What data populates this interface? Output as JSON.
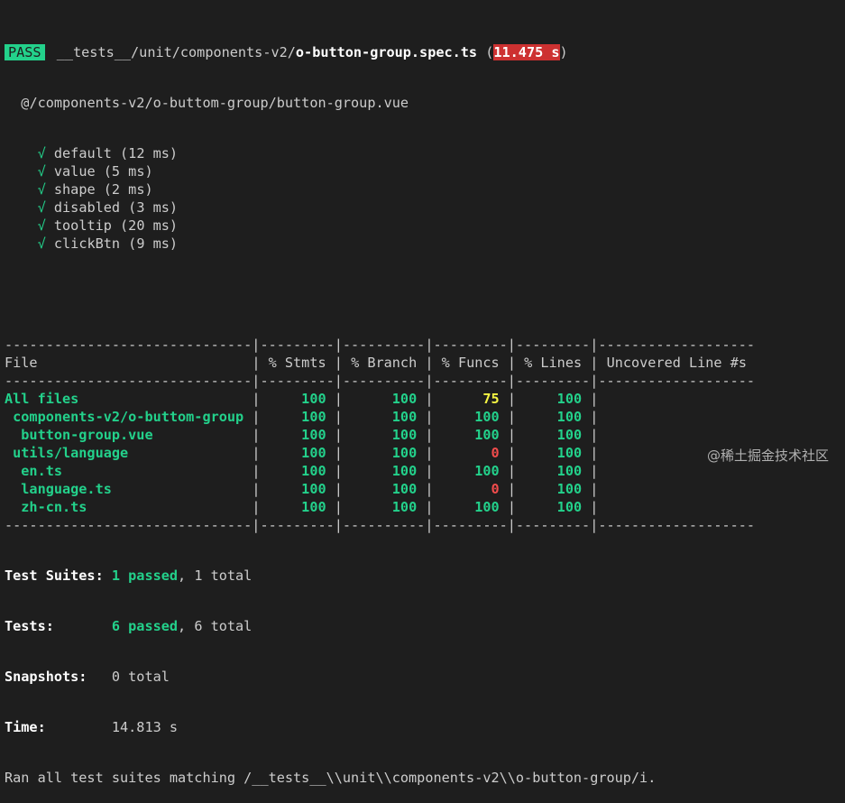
{
  "header": {
    "badge": "PASS",
    "path_dim": "__tests__/unit/components-v2/",
    "path_bold": "o-button-group.spec.ts",
    "time_open": " (",
    "time": "11.475 s",
    "time_close": ")"
  },
  "suite": "@/components-v2/o-buttom-group/button-group.vue",
  "tests": [
    {
      "mark": "√",
      "name": "default (12 ms)"
    },
    {
      "mark": "√",
      "name": "value (5 ms)"
    },
    {
      "mark": "√",
      "name": "shape (2 ms)"
    },
    {
      "mark": "√",
      "name": "disabled (3 ms)"
    },
    {
      "mark": "√",
      "name": "tooltip (20 ms)"
    },
    {
      "mark": "√",
      "name": "clickBtn (9 ms)"
    }
  ],
  "coverage": {
    "separator": "------------------------------|---------|----------|---------|---------|-------------------",
    "headers": [
      "File",
      "% Stmts",
      "% Branch",
      "% Funcs",
      "% Lines",
      "Uncovered Line #s"
    ],
    "rows": [
      {
        "file": "All files",
        "stmts": "100",
        "branch": "100",
        "funcs": "75",
        "lines": "100",
        "uncovered": "",
        "funcs_status": "warn"
      },
      {
        "file": " components-v2/o-buttom-group",
        "stmts": "100",
        "branch": "100",
        "funcs": "100",
        "lines": "100",
        "uncovered": "",
        "funcs_status": "ok"
      },
      {
        "file": "  button-group.vue",
        "stmts": "100",
        "branch": "100",
        "funcs": "100",
        "lines": "100",
        "uncovered": "",
        "funcs_status": "ok"
      },
      {
        "file": " utils/language",
        "stmts": "100",
        "branch": "100",
        "funcs": "0",
        "lines": "100",
        "uncovered": "",
        "funcs_status": "bad"
      },
      {
        "file": "  en.ts",
        "stmts": "100",
        "branch": "100",
        "funcs": "100",
        "lines": "100",
        "uncovered": "",
        "funcs_status": "ok"
      },
      {
        "file": "  language.ts",
        "stmts": "100",
        "branch": "100",
        "funcs": "0",
        "lines": "100",
        "uncovered": "",
        "funcs_status": "bad"
      },
      {
        "file": "  zh-cn.ts",
        "stmts": "100",
        "branch": "100",
        "funcs": "100",
        "lines": "100",
        "uncovered": "",
        "funcs_status": "ok"
      }
    ]
  },
  "summary": {
    "suites_label": "Test Suites: ",
    "suites_passed": "1 passed",
    "suites_total": ", 1 total",
    "tests_label": "Tests:       ",
    "tests_passed": "6 passed",
    "tests_total": ", 6 total",
    "snapshots_label": "Snapshots:   ",
    "snapshots_value": "0 total",
    "time_label": "Time:        ",
    "time_value": "14.813 s",
    "ran": "Ran all test suites matching /__tests__\\\\unit\\\\components-v2\\\\o-button-group/i."
  },
  "watermark": "@稀土掘金技术社区",
  "colors": {
    "background": "#1e1e1e",
    "pass": "#23d18b",
    "warn": "#f5f543",
    "fail": "#f14c4c",
    "slow_bg": "#cd3131"
  }
}
